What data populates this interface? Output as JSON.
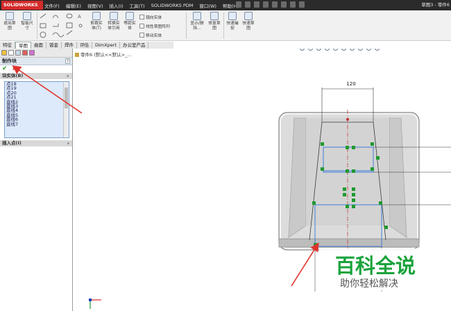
{
  "app": {
    "logo_text": "SOLIDWORKS",
    "window_title": "草图3 - 零件6"
  },
  "menu": [
    "文件(F)",
    "编辑(E)",
    "视图(V)",
    "插入(I)",
    "工具(T)",
    "SOLIDWORKS PDM",
    "窗口(W)",
    "帮助(H)"
  ],
  "ribbon": {
    "exit_sketch": "退出草图",
    "smart_dimension": "智能尺寸",
    "trim_entities": "剪裁实体(T)",
    "convert_entities": "转换实体引用",
    "offset_entities": "等距实体",
    "mirror_entities": "镜向实体",
    "linear_pattern": "线性草图阵列",
    "move_entities": "移动实体",
    "display_delete": "显示/删除...",
    "repair_sketch": "修复草图",
    "quick_snaps": "快速捕捉",
    "rapid_sketch": "快速草图"
  },
  "tabs": [
    "特征",
    "草图",
    "曲面",
    "钣金",
    "焊件",
    "评估",
    "DimXpert",
    "办公室产品"
  ],
  "active_tab": "草图",
  "panel": {
    "title": "制作块",
    "help": "?",
    "ok_symbol": "✔",
    "cancel_symbol": "✖",
    "block_group": "块实体(B)",
    "block_items": [
      "点18",
      "点19",
      "点20",
      "点21",
      "直线2",
      "直线3",
      "直线4",
      "直线5",
      "直线6",
      "直线7"
    ],
    "insert_group": "插入点(I)",
    "collapse_symbol": "»",
    "expand_symbol": "»"
  },
  "canvas": {
    "tree_label": "零件6 (默认<<默认>_...",
    "dimension_value": "120"
  },
  "watermark": {
    "title": "百科全说",
    "subtitle": "助你轻松解决"
  },
  "colors": {
    "titlebar": "#2b2b2b",
    "logo": "#d42b2b",
    "sketch_line": "#3f7fd9",
    "point": "#1f9a2f",
    "annotation_arrow": "#e0342f",
    "watermark": "#1aa33c"
  }
}
